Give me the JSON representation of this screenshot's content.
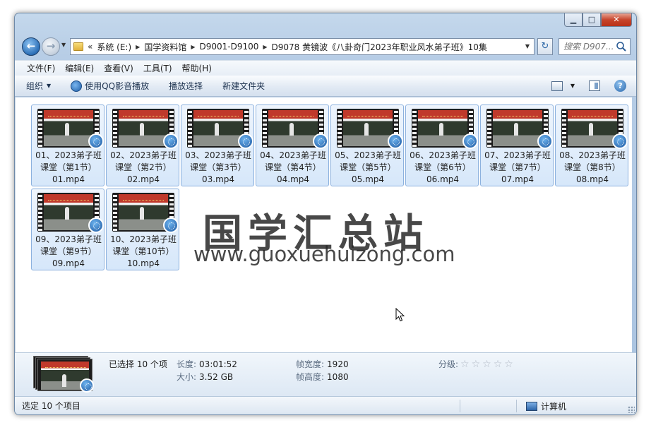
{
  "window": {
    "caption": {
      "minimize": "▁",
      "maximize": "□",
      "close": "✕"
    }
  },
  "nav": {
    "back_glyph": "←",
    "forward_glyph": "→",
    "breadcrumb_overflow": "«",
    "breadcrumbs": [
      "系统 (E:)",
      "国学资料馆",
      "D9001-D9100",
      "D9078 黄镜波《八卦奇门2023年职业风水弟子班》10集"
    ],
    "refresh_glyph": "↻",
    "search_placeholder": "搜索 D907..."
  },
  "menubar": {
    "items": [
      "文件(F)",
      "编辑(E)",
      "查看(V)",
      "工具(T)",
      "帮助(H)"
    ]
  },
  "toolbar": {
    "organize": "组织",
    "qq_play": "使用QQ影音播放",
    "play_selection": "播放选择",
    "new_folder": "新建文件夹",
    "help_glyph": "?"
  },
  "files": [
    {
      "line1": "01、2023弟子班",
      "line2": "课堂（第1节）",
      "line3": "01.mp4"
    },
    {
      "line1": "02、2023弟子班",
      "line2": "课堂（第2节）",
      "line3": "02.mp4"
    },
    {
      "line1": "03、2023弟子班",
      "line2": "课堂（第3节）",
      "line3": "03.mp4"
    },
    {
      "line1": "04、2023弟子班",
      "line2": "课堂（第4节）",
      "line3": "04.mp4"
    },
    {
      "line1": "05、2023弟子班",
      "line2": "课堂（第5节）",
      "line3": "05.mp4"
    },
    {
      "line1": "06、2023弟子班",
      "line2": "课堂（第6节）",
      "line3": "06.mp4"
    },
    {
      "line1": "07、2023弟子班",
      "line2": "课堂（第7节）",
      "line3": "07.mp4"
    },
    {
      "line1": "08、2023弟子班",
      "line2": "课堂（第8节）",
      "line3": "08.mp4"
    },
    {
      "line1": "09、2023弟子班",
      "line2": "课堂（第9节）",
      "line3": "09.mp4"
    },
    {
      "line1": "10、2023弟子班",
      "line2": "课堂（第10节）",
      "line3": "10.mp4"
    }
  ],
  "watermark": {
    "chinese": "国学汇总站",
    "url": "www.guoxuehuizong.com"
  },
  "details": {
    "selected": "已选择 10 个项",
    "length_label": "长度:",
    "length_value": "03:01:52",
    "size_label": "大小:",
    "size_value": "3.52 GB",
    "frame_width_label": "帧宽度:",
    "frame_width_value": "1920",
    "frame_height_label": "帧高度:",
    "frame_height_value": "1080",
    "rating_label": "分级:",
    "rating_stars": 0,
    "rating_max": 5
  },
  "status": {
    "left": "选定 10 个项目",
    "computer": "计算机"
  },
  "colors": {
    "tile_border": "#8cb1de",
    "accent": "#2c64a8"
  }
}
